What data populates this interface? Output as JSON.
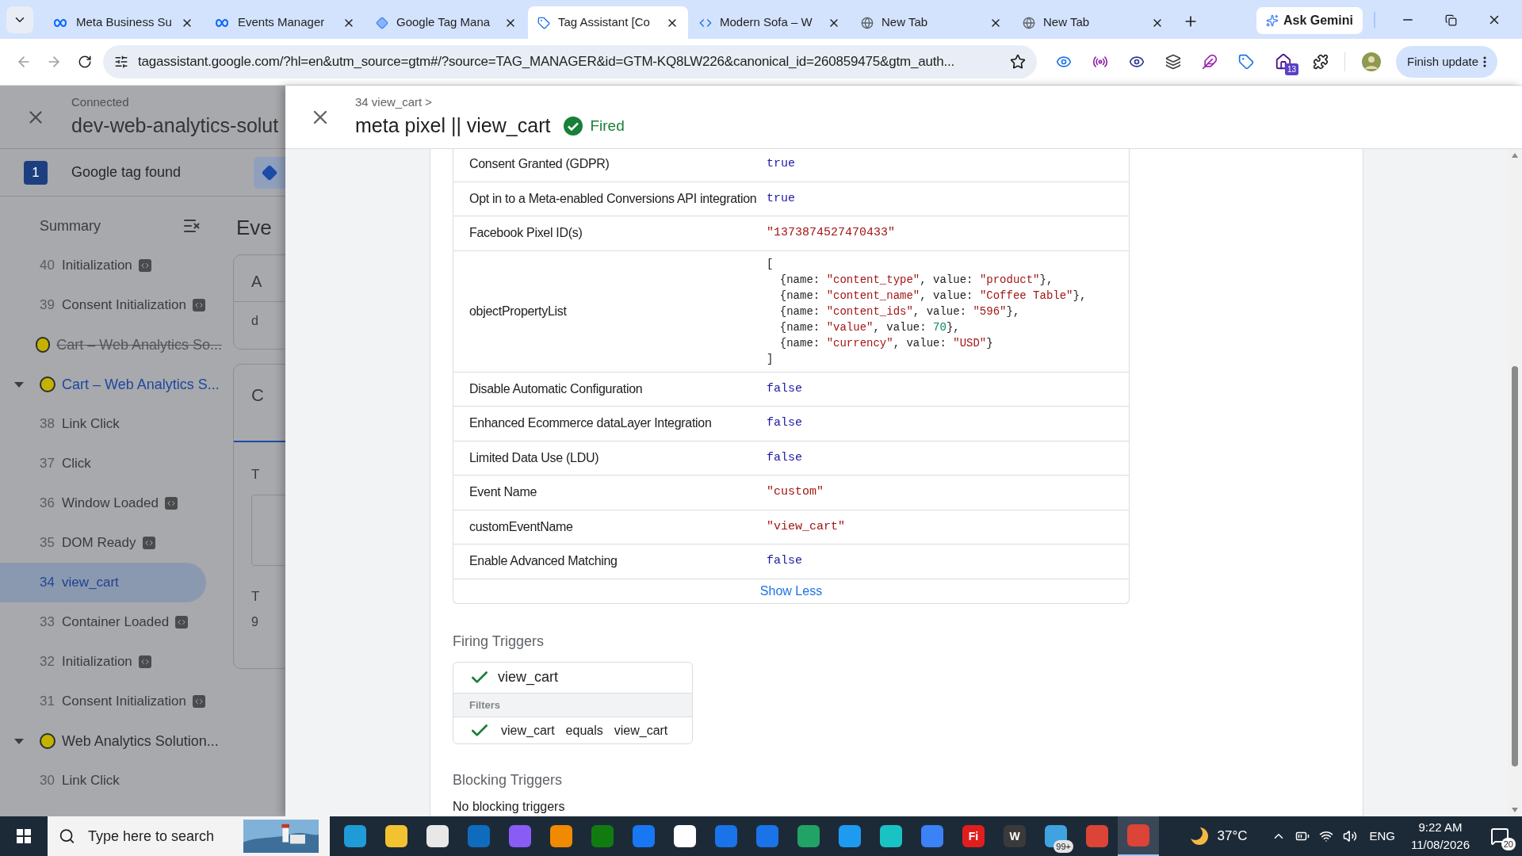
{
  "browser": {
    "tabs": [
      {
        "title": "Meta Business Su",
        "kind": "meta",
        "selected": false
      },
      {
        "title": "Events Manager",
        "kind": "meta",
        "selected": false
      },
      {
        "title": "Google Tag Mana",
        "kind": "gtm",
        "selected": false
      },
      {
        "title": "Tag Assistant [Co",
        "kind": "tag",
        "selected": true
      },
      {
        "title": "Modern Sofa – W",
        "kind": "page",
        "selected": false
      },
      {
        "title": "New Tab",
        "kind": "chrome",
        "selected": false
      },
      {
        "title": "New Tab",
        "kind": "chrome",
        "selected": false
      }
    ],
    "gemini_button": "Ask Gemini",
    "url": "tagassistant.google.com/?hl=en&utm_source=gtm#/?source=TAG_MANAGER&id=GTM-KQ8LW226&canonical_id=260859475&gtm_auth...",
    "extensions_badge": "13",
    "update_button": "Finish update"
  },
  "sidebar": {
    "status": "Connected",
    "domain": "dev-web-analytics-solut",
    "tag_count": "1",
    "tag_label": "Google tag found",
    "summary": "Summary",
    "items": [
      {
        "kind": "event",
        "number": "40",
        "label": "Initialization",
        "api": true,
        "selected": false
      },
      {
        "kind": "event",
        "number": "39",
        "label": "Consent Initialization",
        "api": true,
        "selected": false
      },
      {
        "kind": "page",
        "label": "Cart – Web Analytics So...",
        "color": "#c3b300",
        "struck": true,
        "current": false
      },
      {
        "kind": "page",
        "label": "Cart – Web Analytics S...",
        "color": "#c3b300",
        "struck": false,
        "current": true,
        "expanded": true
      },
      {
        "kind": "event",
        "number": "38",
        "label": "Link Click",
        "api": false,
        "selected": false
      },
      {
        "kind": "event",
        "number": "37",
        "label": "Click",
        "api": false,
        "selected": false
      },
      {
        "kind": "event",
        "number": "36",
        "label": "Window Loaded",
        "api": true,
        "selected": false
      },
      {
        "kind": "event",
        "number": "35",
        "label": "DOM Ready",
        "api": true,
        "selected": false
      },
      {
        "kind": "event",
        "number": "34",
        "label": "view_cart",
        "api": false,
        "selected": true
      },
      {
        "kind": "event",
        "number": "33",
        "label": "Container Loaded",
        "api": true,
        "selected": false
      },
      {
        "kind": "event",
        "number": "32",
        "label": "Initialization",
        "api": true,
        "selected": false
      },
      {
        "kind": "event",
        "number": "31",
        "label": "Consent Initialization",
        "api": true,
        "selected": false
      },
      {
        "kind": "page",
        "label": "Web Analytics Solution...",
        "color": "#c3b300",
        "struck": false,
        "current": false,
        "expanded": true
      },
      {
        "kind": "event",
        "number": "30",
        "label": "Link Click",
        "api": false,
        "selected": false
      }
    ]
  },
  "background_fragments": {
    "heading": "Eve",
    "card_1": [
      "A",
      "d"
    ],
    "card_2": [
      "C",
      "T",
      "T",
      "9"
    ]
  },
  "drawer": {
    "breadcrumb": "34 view_cart >",
    "title": "meta pixel || view_cart",
    "status": "Fired",
    "properties": [
      {
        "label": "Consent Granted (GDPR)",
        "kind": "keyword",
        "value": "true"
      },
      {
        "label": "Opt in to a Meta-enabled Conversions API integration",
        "kind": "keyword",
        "value": "true"
      },
      {
        "label": "Facebook Pixel ID(s)",
        "kind": "string",
        "value": "\"1373874527470433\""
      },
      {
        "label": "objectPropertyList",
        "kind": "list",
        "lines": [
          [
            {
              "kind": "plain",
              "text": "["
            }
          ],
          [
            {
              "kind": "plain",
              "text": "  {name: "
            },
            {
              "kind": "string",
              "text": "\"content_type\""
            },
            {
              "kind": "plain",
              "text": ", value: "
            },
            {
              "kind": "string",
              "text": "\"product\""
            },
            {
              "kind": "plain",
              "text": "},"
            }
          ],
          [
            {
              "kind": "plain",
              "text": "  {name: "
            },
            {
              "kind": "string",
              "text": "\"content_name\""
            },
            {
              "kind": "plain",
              "text": ", value: "
            },
            {
              "kind": "string",
              "text": "\"Coffee Table\""
            },
            {
              "kind": "plain",
              "text": "},"
            }
          ],
          [
            {
              "kind": "plain",
              "text": "  {name: "
            },
            {
              "kind": "string",
              "text": "\"content_ids\""
            },
            {
              "kind": "plain",
              "text": ", value: "
            },
            {
              "kind": "string",
              "text": "\"596\""
            },
            {
              "kind": "plain",
              "text": "},"
            }
          ],
          [
            {
              "kind": "plain",
              "text": "  {name: "
            },
            {
              "kind": "string",
              "text": "\"value\""
            },
            {
              "kind": "plain",
              "text": ", value: "
            },
            {
              "kind": "number",
              "text": "70"
            },
            {
              "kind": "plain",
              "text": "},"
            }
          ],
          [
            {
              "kind": "plain",
              "text": "  {name: "
            },
            {
              "kind": "string",
              "text": "\"currency\""
            },
            {
              "kind": "plain",
              "text": ", value: "
            },
            {
              "kind": "string",
              "text": "\"USD\""
            },
            {
              "kind": "plain",
              "text": "}"
            }
          ],
          [
            {
              "kind": "plain",
              "text": "]"
            }
          ]
        ]
      },
      {
        "label": "Disable Automatic Configuration",
        "kind": "keyword",
        "value": "false"
      },
      {
        "label": "Enhanced Ecommerce dataLayer Integration",
        "kind": "keyword",
        "value": "false"
      },
      {
        "label": "Limited Data Use (LDU)",
        "kind": "keyword",
        "value": "false"
      },
      {
        "label": "Event Name",
        "kind": "string",
        "value": "\"custom\""
      },
      {
        "label": "customEventName",
        "kind": "string",
        "value": "\"view_cart\""
      },
      {
        "label": "Enable Advanced Matching",
        "kind": "keyword",
        "value": "false"
      }
    ],
    "show_less": "Show Less",
    "firing_title": "Firing Triggers",
    "trigger": {
      "name": "view_cart",
      "passed": true,
      "filters_title": "Filters",
      "filters": [
        {
          "variable": "view_cart",
          "operator": "equals",
          "value": "view_cart",
          "passed": true
        }
      ]
    },
    "blocking_title": "Blocking Triggers",
    "blocking_text": "No blocking triggers"
  },
  "taskbar": {
    "search_placeholder": "Type here to search",
    "apps": [
      {
        "color": "#1f9bd8",
        "selected": false
      },
      {
        "color": "#f2c230",
        "selected": false
      },
      {
        "color": "#e8e8e8",
        "selected": false
      },
      {
        "color": "#0f6cbd",
        "selected": false
      },
      {
        "color": "#8a5cf6",
        "selected": false
      },
      {
        "color": "#f08a00",
        "selected": false
      },
      {
        "color": "#107c10",
        "selected": false
      },
      {
        "color": "#1877f2",
        "selected": false
      },
      {
        "color": "#ffffff",
        "selected": false
      },
      {
        "color": "#1a73e8",
        "selected": false
      },
      {
        "color": "#1a73e8",
        "selected": false
      },
      {
        "color": "#21a366",
        "selected": false
      },
      {
        "color": "#1d9bf0",
        "selected": false
      },
      {
        "color": "#19c3c3",
        "selected": false
      },
      {
        "color": "#3b82f6",
        "selected": false
      },
      {
        "color": "#e01e1e",
        "glyph": "Fi",
        "selected": false
      },
      {
        "color": "#3a3a3a",
        "glyph": "W",
        "selected": false
      },
      {
        "color": "#3fa3e0",
        "badge": "99+",
        "selected": false
      },
      {
        "color": "#db4437",
        "selected": false
      },
      {
        "color": "#db4437",
        "selected": true
      }
    ],
    "weather": "37°C",
    "language": "ENG",
    "time": "9:22 AM",
    "date": "11/08/2026",
    "notifications": "20"
  }
}
